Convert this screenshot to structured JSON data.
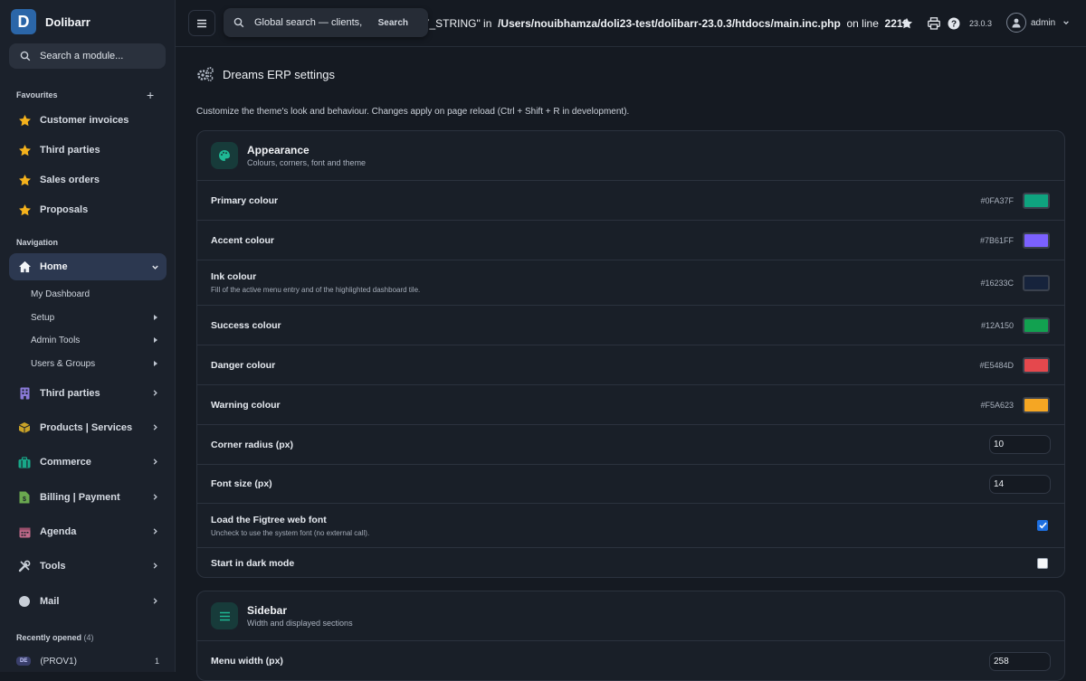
{
  "brand": {
    "logo_letter": "D",
    "name": "Dolibarr"
  },
  "module_search": {
    "placeholder": "Search a module..."
  },
  "favourites": {
    "heading": "Favourites",
    "add_label": "+",
    "items": [
      {
        "label": "Customer invoices",
        "icon": "star-icon"
      },
      {
        "label": "Third parties",
        "icon": "star-icon"
      },
      {
        "label": "Sales orders",
        "icon": "star-icon"
      },
      {
        "label": "Proposals",
        "icon": "star-icon"
      }
    ]
  },
  "navigation": {
    "heading": "Navigation",
    "home": {
      "label": "Home",
      "icon": "home-icon",
      "expanded": true
    },
    "home_sub": [
      {
        "label": "My Dashboard",
        "has_children": false
      },
      {
        "label": "Setup",
        "has_children": true
      },
      {
        "label": "Admin Tools",
        "has_children": true
      },
      {
        "label": "Users & Groups",
        "has_children": true
      }
    ],
    "items": [
      {
        "label": "Third parties",
        "icon": "building-icon",
        "color": "#8a7ad8"
      },
      {
        "label": "Products | Services",
        "icon": "box-icon",
        "color": "#c9a227"
      },
      {
        "label": "Commerce",
        "icon": "briefcase-icon",
        "color": "#18a889"
      },
      {
        "label": "Billing | Payment",
        "icon": "invoice-icon",
        "color": "#6aa84f"
      },
      {
        "label": "Agenda",
        "icon": "calendar-icon",
        "color": "#c06a8a"
      },
      {
        "label": "Tools",
        "icon": "tools-icon",
        "color": "#c8ced7"
      },
      {
        "label": "Mail",
        "icon": "mail-icon",
        "color": "#c8ced7"
      }
    ]
  },
  "recent": {
    "heading": "Recently opened",
    "count": "(4)",
    "items": [
      {
        "badge": "DE",
        "label": "(PROV1)",
        "count": "1"
      }
    ]
  },
  "topbar": {
    "error_prefix": "ERY_STRING\" in",
    "error_path": "/Users/nouibhamza/doli23-test/dolibarr-23.0.3/htdocs/main.inc.php",
    "error_mid": "on line",
    "error_line": "2219",
    "version": "23.0.3",
    "user": "admin"
  },
  "global_search": {
    "placeholder": "Global search — clients,",
    "button": "Search"
  },
  "page": {
    "title": "Dreams ERP settings",
    "description": "Customize the theme's look and behaviour. Changes apply on page reload (Ctrl + Shift + R in development)."
  },
  "appearance": {
    "title": "Appearance",
    "subtitle": "Colours, corners, font and theme",
    "colours": [
      {
        "label": "Primary colour",
        "help": "",
        "hex": "#0FA37F"
      },
      {
        "label": "Accent colour",
        "help": "",
        "hex": "#7B61FF"
      },
      {
        "label": "Ink colour",
        "help": "Fill of the active menu entry and of the highlighted dashboard tile.",
        "hex": "#16233C"
      },
      {
        "label": "Success colour",
        "help": "",
        "hex": "#12A150"
      },
      {
        "label": "Danger colour",
        "help": "",
        "hex": "#E5484D"
      },
      {
        "label": "Warning colour",
        "help": "",
        "hex": "#F5A623"
      }
    ],
    "corner_radius": {
      "label": "Corner radius (px)",
      "value": "10"
    },
    "font_size": {
      "label": "Font size (px)",
      "value": "14"
    },
    "web_font": {
      "label": "Load the Figtree web font",
      "help": "Uncheck to use the system font (no external call).",
      "checked": true
    },
    "dark_mode": {
      "label": "Start in dark mode",
      "checked": false
    }
  },
  "sidebar_card": {
    "title": "Sidebar",
    "subtitle": "Width and displayed sections",
    "menu_width": {
      "label": "Menu width (px)",
      "value": "258"
    }
  }
}
